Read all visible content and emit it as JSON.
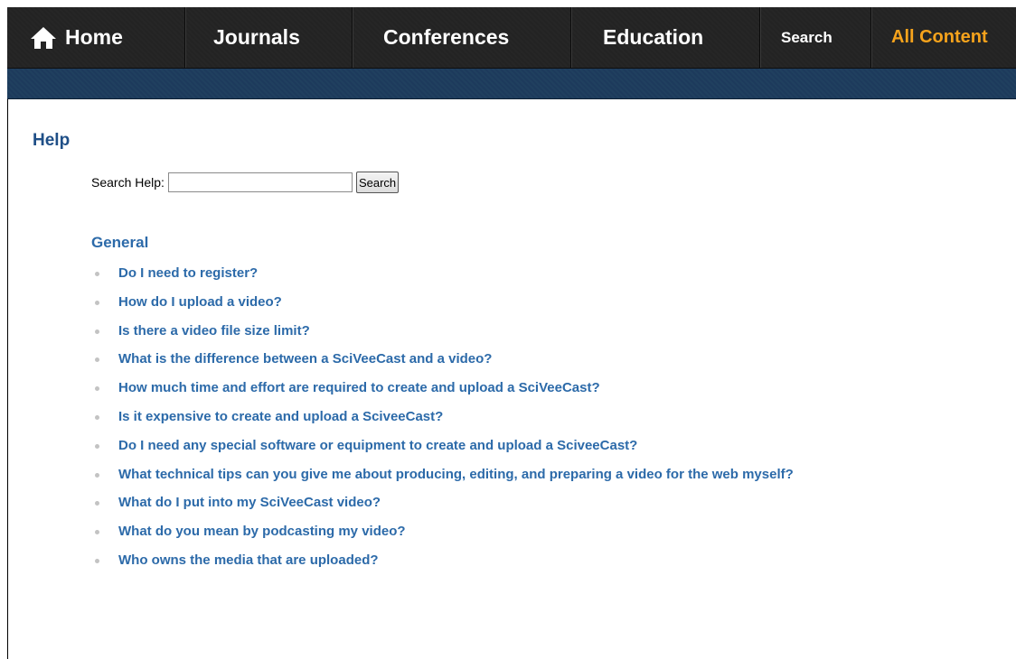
{
  "nav": {
    "items": [
      {
        "label": "Home",
        "icon": "home-icon"
      },
      {
        "label": "Journals"
      },
      {
        "label": "Conferences"
      },
      {
        "label": "Education"
      },
      {
        "label": "Search"
      },
      {
        "label": "All Content"
      }
    ],
    "accent_color": "#f6a31c"
  },
  "page": {
    "title": "Help",
    "search": {
      "label": "Search Help:",
      "value": "",
      "placeholder": "",
      "button_label": "Search"
    },
    "section": {
      "title": "General",
      "items": [
        "Do I need to register?",
        "How do I upload a video?",
        "Is there a video file size limit?",
        "What is the difference between a SciVeeCast and a video?",
        "How much time and effort are required to create and upload a SciVeeCast?",
        "Is it expensive to create and upload a SciveeCast?",
        "Do I need any special software or equipment to create and upload a SciveeCast?",
        "What technical tips can you give me about producing, editing, and preparing a video for the web myself?",
        "What do I put into my SciVeeCast video?",
        "What do you mean by podcasting my video?",
        "Who owns the media that are uploaded?"
      ]
    },
    "link_color": "#2c6aa9",
    "title_color": "#1f4f87"
  }
}
